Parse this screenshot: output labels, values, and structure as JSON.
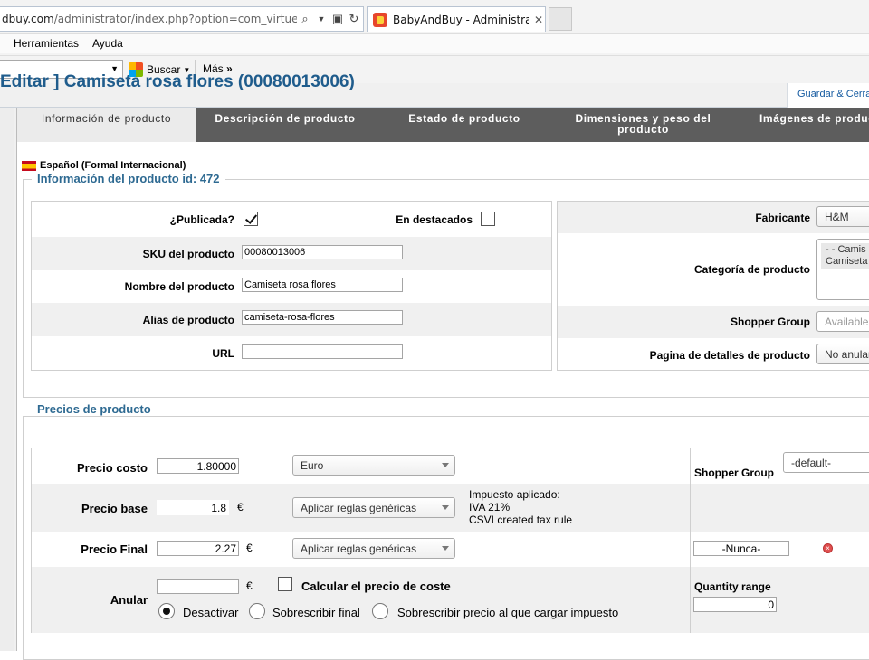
{
  "browser": {
    "address_prefix": "dbuy.com",
    "address_rest": "/administrator/index.php?option=com_virtuemart&v",
    "tab_title": "BabyAndBuy - Administraci...",
    "menu": [
      "Herramientas",
      "Ayuda"
    ],
    "toolbar": {
      "search_label": "Buscar",
      "more_label": "Más"
    }
  },
  "header": {
    "title": "Editar ] Camiseta rosa flores (00080013006)",
    "save_close": "Guardar & Cerrar"
  },
  "tabs": [
    "Información de producto",
    "Descripción de producto",
    "Estado de producto",
    "Dimensiones y peso del producto",
    "Imágenes de producto"
  ],
  "language": "Español (Formal Internacional)",
  "info": {
    "legend": "Información del producto id: 472",
    "published_label": "¿Publicada?",
    "published": true,
    "featured_label": "En destacados",
    "featured": false,
    "sku_label": "SKU del producto",
    "sku": "00080013006",
    "name_label": "Nombre del producto",
    "name": "Camiseta rosa flores",
    "alias_label": "Alias de producto",
    "alias": "camiseta-rosa-flores",
    "url_label": "URL",
    "url": "",
    "manufacturer_label": "Fabricante",
    "manufacturer": "H&M",
    "category_label": "Categoría de producto",
    "category_line1": "- - Camis",
    "category_line2": "Camiseta",
    "shopper_label": "Shopper Group",
    "shopper_placeholder": "Available f",
    "details_label": "Pagina de detalles de producto",
    "details_value": "No anular"
  },
  "prices": {
    "legend": "Precios de producto",
    "cost_label": "Precio costo",
    "cost": "1.80000",
    "currency": "Euro",
    "shopper_group_label": "Shopper Group",
    "shopper_group": "-default-",
    "base_label": "Precio base",
    "base": "1.8",
    "euro_symbol": "€",
    "rule_select": "Aplicar reglas genéricas",
    "tax_line1": "Impuesto aplicado:",
    "tax_line2": "IVA 21%",
    "tax_line3": "CSVI created tax rule",
    "final_label": "Precio Final",
    "final": "2.27",
    "rule_select2": "Aplicar reglas genéricas",
    "never": "-Nunca-",
    "override_label": "Anular",
    "override": "",
    "calc_cost_label": "Calcular el precio de coste",
    "calc_cost": false,
    "radio_deactivate": "Desactivar",
    "radio_final": "Sobrescribir final",
    "radio_pretax": "Sobrescribir precio al que cargar impuesto",
    "quantity_label": "Quantity range",
    "quantity": "0"
  }
}
